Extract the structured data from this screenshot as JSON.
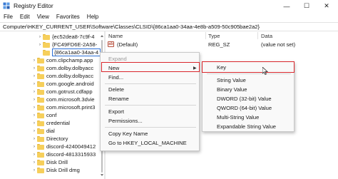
{
  "window": {
    "title": "Registry Editor",
    "controls": {
      "minimize": "—",
      "maximize": "☐",
      "close": "✕"
    }
  },
  "menubar": [
    "File",
    "Edit",
    "View",
    "Favorites",
    "Help"
  ],
  "address": "Computer\\HKEY_CURRENT_USER\\Software\\Classes\\CLSID\\{86ca1aa0-34aa-4e8b-a509-50c905bae2a2}",
  "tree": [
    {
      "label": "{ec52dea8-7c9f-4",
      "expander": "›"
    },
    {
      "label": "{FC49FD6E-2A58-",
      "expander": "›"
    },
    {
      "label": "{86ca1aa0-34aa-4",
      "expander": ""
    },
    {
      "label": "com.clipchamp.app",
      "expander": "›"
    },
    {
      "label": "com.dolby.dolbyacc",
      "expander": "›"
    },
    {
      "label": "com.dolby.dolbyacc",
      "expander": "›"
    },
    {
      "label": "com.google.android",
      "expander": "›"
    },
    {
      "label": "com.gotrust.cdfapp",
      "expander": "›"
    },
    {
      "label": "com.microsoft.3dvie",
      "expander": "›"
    },
    {
      "label": "com.microsoft.print3",
      "expander": "›"
    },
    {
      "label": "conf",
      "expander": "›"
    },
    {
      "label": "credential",
      "expander": "›"
    },
    {
      "label": "dial",
      "expander": "›"
    },
    {
      "label": "Directory",
      "expander": "›"
    },
    {
      "label": "discord-4240049412",
      "expander": "›"
    },
    {
      "label": "discord-4813315933",
      "expander": "›"
    },
    {
      "label": "Disk Drill",
      "expander": "›"
    },
    {
      "label": "Disk Drill dmg",
      "expander": "›"
    }
  ],
  "list": {
    "headers": {
      "name": "Name",
      "type": "Type",
      "data": "Data"
    },
    "rows": [
      {
        "icon": "ab",
        "name": "(Default)",
        "type": "REG_SZ",
        "data": "(value not set)"
      }
    ]
  },
  "context_menu": {
    "items": [
      {
        "label": "Expand",
        "disabled": true
      },
      {
        "label": "New",
        "submenu": true,
        "highlighted": true
      },
      {
        "label": "Find..."
      },
      {
        "label": "Delete"
      },
      {
        "label": "Rename"
      },
      {
        "label": "Export"
      },
      {
        "label": "Permissions..."
      },
      {
        "label": "Copy Key Name"
      },
      {
        "label": "Go to HKEY_LOCAL_MACHINE"
      }
    ]
  },
  "submenu": {
    "items": [
      {
        "label": "Key",
        "highlighted": true
      },
      {
        "label": "String Value"
      },
      {
        "label": "Binary Value"
      },
      {
        "label": "DWORD (32-bit) Value"
      },
      {
        "label": "QWORD (64-bit) Value"
      },
      {
        "label": "Multi-String Value"
      },
      {
        "label": "Expandable String Value"
      }
    ]
  },
  "colors": {
    "highlight_box": "#d9262b",
    "folder": "#f6cf5b",
    "selection_border": "#2b6fd6"
  }
}
